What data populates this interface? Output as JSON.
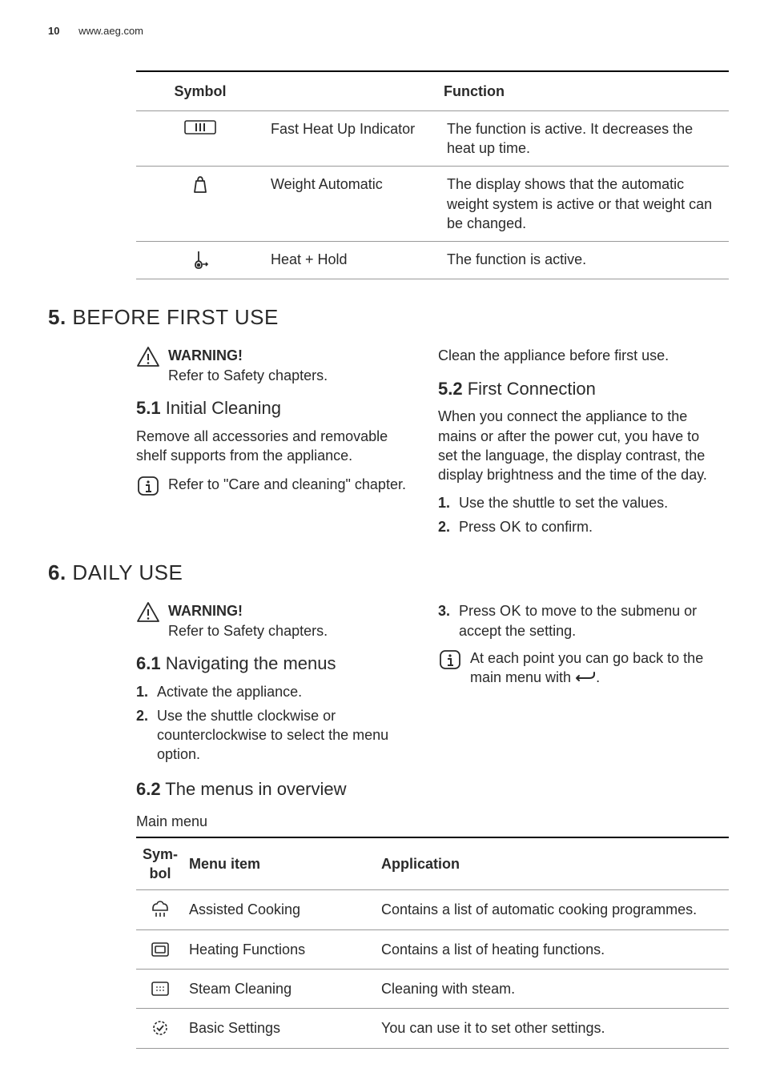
{
  "header": {
    "page_number": "10",
    "url": "www.aeg.com"
  },
  "top_table": {
    "headers": {
      "symbol": "Symbol",
      "function": "Function"
    },
    "rows": [
      {
        "name": "Fast Heat Up Indicator",
        "desc": "The function is active. It decreases the heat up time."
      },
      {
        "name": "Weight Automatic",
        "desc": "The display shows that the automatic weight system is active or that weight can be changed."
      },
      {
        "name": "Heat + Hold",
        "desc": "The function is active."
      }
    ]
  },
  "s5": {
    "heading_num": "5.",
    "heading_text": " BEFORE FIRST USE",
    "warning_title": "WARNING!",
    "warning_text": "Refer to Safety chapters.",
    "s51_num": "5.1",
    "s51_title": " Initial Cleaning",
    "s51_body": "Remove all accessories and removable shelf supports from the appliance.",
    "s51_info": "Refer to \"Care and cleaning\" chapter.",
    "s52_pre": "Clean the appliance before first use.",
    "s52_num": "5.2",
    "s52_title": " First Connection",
    "s52_body": "When you connect the appliance to the mains or after the power cut, you have to set the language, the display contrast, the display brightness and the time of the day.",
    "s52_step1": "Use the shuttle to set the values.",
    "s52_step2_a": "Press ",
    "s52_step2_b": " to confirm.",
    "ok_label": "OK"
  },
  "s6": {
    "heading_num": "6.",
    "heading_text": " DAILY USE",
    "warning_title": "WARNING!",
    "warning_text": "Refer to Safety chapters.",
    "s61_num": "6.1",
    "s61_title": " Navigating the menus",
    "s61_step1": "Activate the appliance.",
    "s61_step2": "Use the shuttle clockwise or counterclockwise to select the menu option.",
    "s61_step3_a": "Press ",
    "s61_step3_b": " to move to the submenu or accept the setting.",
    "ok_label": "OK",
    "s61_info_a": "At each point you can go back to the main menu with ",
    "s61_info_b": ".",
    "s62_num": "6.2",
    "s62_title": " The menus in overview",
    "main_menu_label": "Main menu"
  },
  "main_table": {
    "headers": {
      "symbol": "Sym­bol",
      "menu": "Menu item",
      "app": "Application"
    },
    "rows": [
      {
        "name": "Assisted Cooking",
        "desc": "Contains a list of automatic cooking programmes."
      },
      {
        "name": "Heating Functions",
        "desc": "Contains a list of heating functions."
      },
      {
        "name": "Steam Cleaning",
        "desc": "Cleaning with steam."
      },
      {
        "name": "Basic Settings",
        "desc": "You can use it to set other settings."
      }
    ]
  }
}
